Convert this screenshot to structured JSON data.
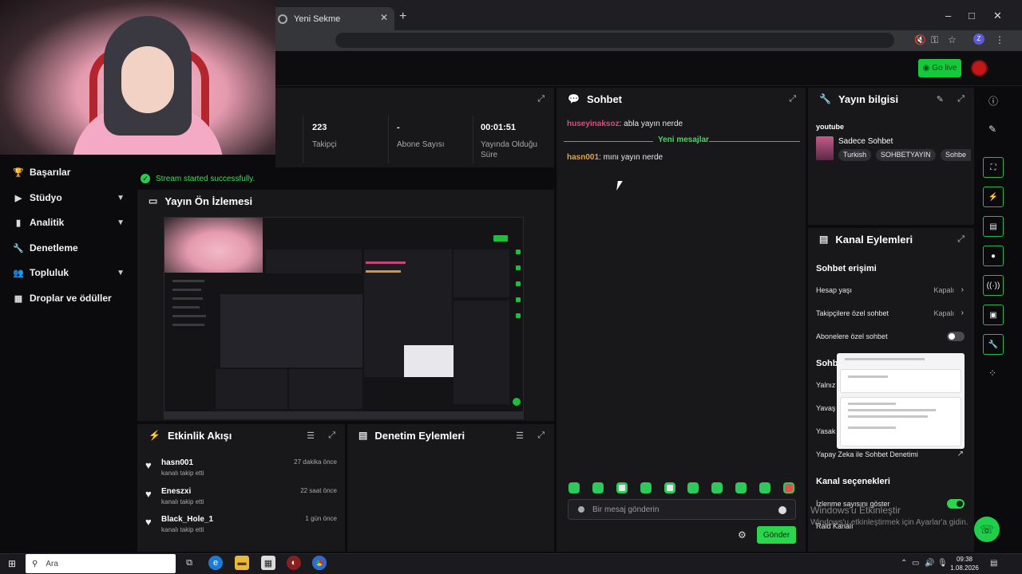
{
  "browser": {
    "tab_title": "Yeni Sekme",
    "new_tab": "+",
    "minimize": "–",
    "maximize": "□",
    "close": "✕",
    "profile_letter": "Z"
  },
  "header": {
    "go_live_label": "Go live"
  },
  "sidebar": {
    "items": [
      {
        "label": "Başarılar",
        "icon": "trophy-icon",
        "has_chevron": false
      },
      {
        "label": "Stüdyo",
        "icon": "video-icon",
        "has_chevron": true
      },
      {
        "label": "Analitik",
        "icon": "chart-icon",
        "has_chevron": true
      },
      {
        "label": "Denetleme",
        "icon": "wrench-icon",
        "has_chevron": false
      },
      {
        "label": "Topluluk",
        "icon": "people-icon",
        "has_chevron": true
      },
      {
        "label": "Droplar ve ödüller",
        "icon": "gift-icon",
        "has_chevron": false
      }
    ]
  },
  "stats": {
    "items": [
      {
        "value": "223",
        "label": "Takipçi"
      },
      {
        "value": "-",
        "label": "Abone Sayısı"
      },
      {
        "value": "00:01:51",
        "label": "Yayında Olduğu Süre"
      }
    ]
  },
  "toast": {
    "text": "Stream started successfully."
  },
  "preview": {
    "title": "Yayın Ön İzlemesi"
  },
  "activity": {
    "title": "Etkinlik Akışı",
    "items": [
      {
        "name": "hasn001",
        "action": "kanalı takip etti",
        "time": "27 dakika önce"
      },
      {
        "name": "Eneszxi",
        "action": "kanalı takip etti",
        "time": "22 saat önce"
      },
      {
        "name": "Black_Hole_1",
        "action": "kanalı takip etti",
        "time": "1 gün önce"
      }
    ]
  },
  "moderation": {
    "title": "Denetim Eylemleri"
  },
  "chat": {
    "title": "Sohbet",
    "messages": [
      {
        "user": "huseyinaksoz",
        "text": ": abla yayın nerde"
      },
      {
        "user": "hasn001",
        "text": ": mını yayın nerde"
      }
    ],
    "new_messages_label": "Yeni mesajlar",
    "input_placeholder": "Bir mesaj gönderin",
    "send_label": "Gönder"
  },
  "stream_info": {
    "title": "Yayın bilgisi",
    "platform": "youtube",
    "category": "Sadece Sohbet",
    "tags": [
      "Turkish",
      "SOHBETYAYIN",
      "Sohbe"
    ]
  },
  "channel_actions": {
    "title": "Kanal Eylemleri",
    "chat_access_heading": "Sohbet erişimi",
    "rows": [
      {
        "label": "Hesap yaşı",
        "value": "Kapalı"
      },
      {
        "label": "Takipçilere özel sohbet",
        "value": "Kapalı"
      }
    ],
    "subscriber_only_label": "Abonelere özel sohbet",
    "subscriber_only_on": false,
    "chat_settings_heading": "Sohbet seçenekleri",
    "partial_rows": [
      "Yalnız",
      "Yavaş",
      "Yasak"
    ],
    "ai_moderation_label": "Yapay Zeka ile Sohbet Denetimi",
    "channel_options_heading": "Kanal seçenekleri",
    "viewer_count_label": "İzlenme sayısını göster",
    "viewer_count_on": true,
    "raid_label": "Raid Kanalı"
  },
  "watermark": {
    "line1": "Windows'u Etkinleştir",
    "line2": "Windows'u etkinleştirmek için Ayarlar'a gidin."
  },
  "taskbar": {
    "search_placeholder": "Ara",
    "time": "09:38",
    "date": "1.08.2026"
  },
  "colors": {
    "accent_green": "#2bd64c",
    "chat_user_pink": "#e5487a",
    "chat_user_orange": "#e8a23b",
    "live_red": "#c31818"
  }
}
